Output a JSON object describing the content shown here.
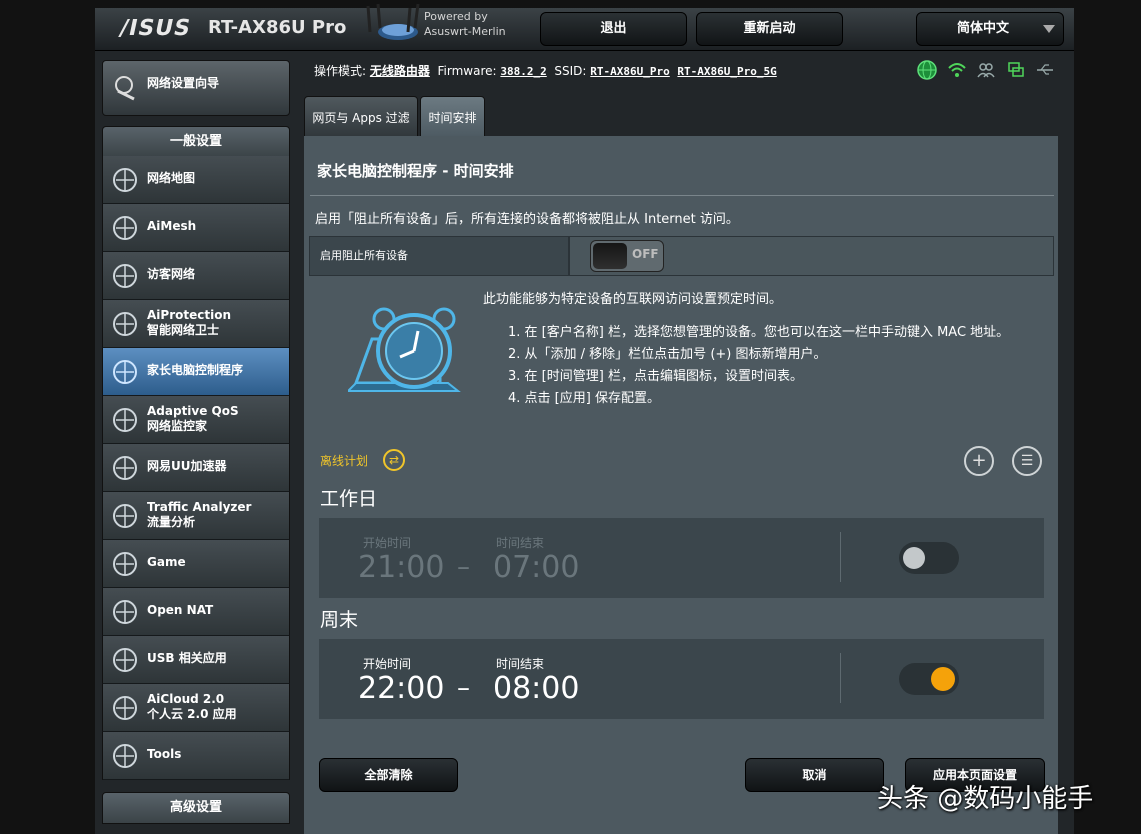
{
  "header": {
    "brand": "/ISUS",
    "model": "RT-AX86U Pro",
    "powered_line1": "Powered by",
    "powered_line2": "Asuswrt-Merlin",
    "logout": "退出",
    "reboot": "重新启动",
    "language": "简体中文"
  },
  "status": {
    "mode_label": "操作模式:",
    "mode_value": "无线路由器",
    "firmware_label": "Firmware:",
    "firmware_value": "388.2_2",
    "ssid_label": "SSID:",
    "ssid_1": "RT-AX86U_Pro",
    "ssid_2": "RT-AX86U_Pro_5G"
  },
  "sidebar": {
    "wizard": "网络设置向导",
    "general_header": "一般设置",
    "items": [
      {
        "label": "网络地图",
        "label2": ""
      },
      {
        "label": "AiMesh",
        "label2": ""
      },
      {
        "label": "访客网络",
        "label2": ""
      },
      {
        "label": "AiProtection",
        "label2": "智能网络卫士"
      },
      {
        "label": "家长电脑控制程序",
        "label2": ""
      },
      {
        "label": "Adaptive QoS",
        "label2": "网络监控家"
      },
      {
        "label": "网易UU加速器",
        "label2": ""
      },
      {
        "label": "Traffic Analyzer",
        "label2": "流量分析"
      },
      {
        "label": "Game",
        "label2": ""
      },
      {
        "label": "Open NAT",
        "label2": ""
      },
      {
        "label": "USB 相关应用",
        "label2": ""
      },
      {
        "label": "AiCloud 2.0",
        "label2": "个人云 2.0 应用"
      },
      {
        "label": "Tools",
        "label2": ""
      }
    ],
    "advanced_header": "高级设置"
  },
  "tabs": [
    {
      "label": "网页与 Apps 过滤"
    },
    {
      "label": "时间安排"
    }
  ],
  "main": {
    "title": "家长电脑控制程序 - 时间安排",
    "description": "启用「阻止所有设备」后，所有连接的设备都将被阻止从 Internet 访问。",
    "block_all_label": "启用阻止所有设备",
    "block_all_state": "OFF",
    "intro": "此功能能够为特定设备的互联网访问设置预定时间。",
    "steps": [
      "1. 在 [客户名称] 栏，选择您想管理的设备。您也可以在这一栏中手动键入 MAC 地址。",
      "2. 从「添加 / 移除」栏位点击加号 (+) 图标新增用户。",
      "3. 在 [时间管理] 栏，点击编辑图标，设置时间表。",
      "4. 点击 [应用] 保存配置。"
    ],
    "offline_plan": "离线计划",
    "schedules": [
      {
        "group": "工作日",
        "start_label": "开始时间",
        "end_label": "时间结束",
        "start": "21:00",
        "end": "07:00",
        "enabled": false
      },
      {
        "group": "周末",
        "start_label": "开始时间",
        "end_label": "时间结束",
        "start": "22:00",
        "end": "08:00",
        "enabled": true
      }
    ],
    "clear_all": "全部清除",
    "cancel": "取消",
    "apply": "应用本页面设置"
  },
  "watermark": "头条 @数码小能手",
  "colors": {
    "accent_orange": "#f5a20a",
    "plan_yellow": "#f0c52a",
    "active_blue": "#4a7fb3"
  }
}
